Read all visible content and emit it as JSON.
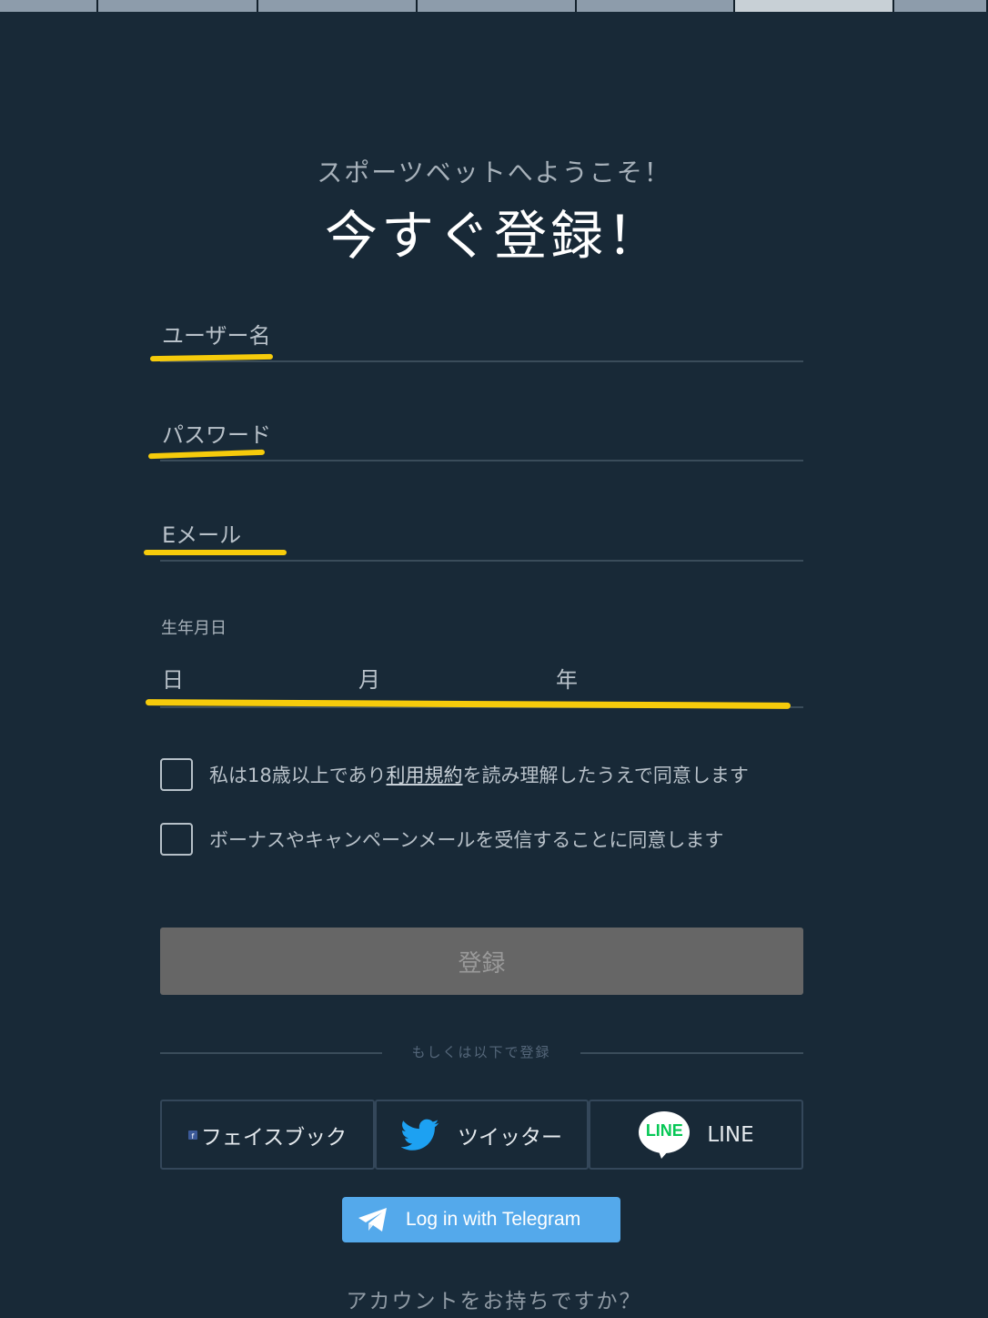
{
  "header": {
    "welcome": "スポーツベットへようこそ！",
    "title": "今すぐ登録！"
  },
  "form": {
    "username_label": "ユーザー名",
    "password_label": "パスワード",
    "email_label": "Eメール",
    "dob": {
      "label": "生年月日",
      "day": "日",
      "month": "月",
      "year": "年"
    }
  },
  "checks": {
    "terms_prefix": "私は18歳以上であり",
    "terms_link": "利用規約",
    "terms_suffix": "を読み理解したうえで同意します",
    "bonus": "ボーナスやキャンペーンメールを受信することに同意します"
  },
  "submit_label": "登録",
  "divider": "もしくは以下で登録",
  "social": {
    "facebook": "フェイスブック",
    "twitter": "ツイッター",
    "line_logo": "LINE",
    "line": "LINE"
  },
  "telegram_label": "Log in with Telegram",
  "footer": {
    "account": "アカウントをお持ちですか？"
  },
  "colors": {
    "background": "#182937",
    "highlight": "#f6cb0b",
    "submit_disabled": "#666666",
    "telegram": "#54a9eb",
    "twitter": "#1da1f2",
    "line": "#06c755"
  },
  "icons": [
    "facebook-icon",
    "twitter-bird-icon",
    "line-icon",
    "telegram-plane-icon"
  ]
}
